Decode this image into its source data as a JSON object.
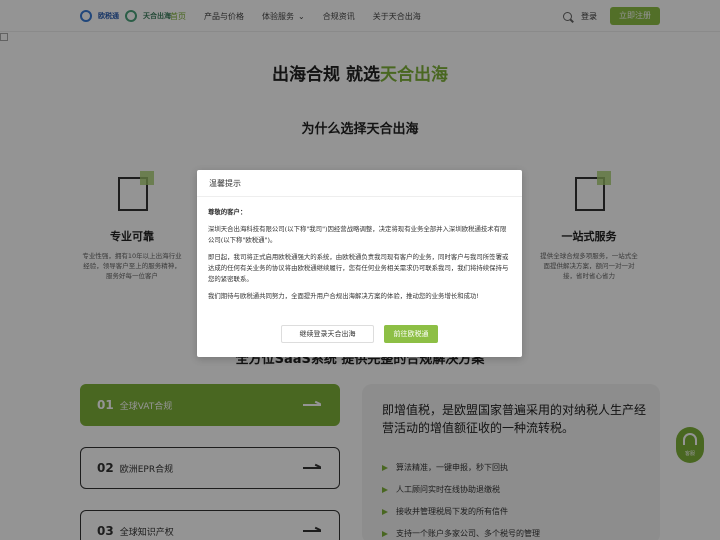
{
  "header": {
    "logo_text_1": "欧税通",
    "logo_text_2": "天合出海",
    "nav": [
      "首页",
      "产品与价格",
      "体验服务",
      "合规资讯",
      "关于天合出海"
    ],
    "login_label": "登录",
    "signup_label": "立即注册"
  },
  "hero": {
    "title_prefix": "出海合规 就选",
    "title_highlight": "天合出海"
  },
  "why": {
    "title": "为什么选择天合出海",
    "cards": [
      {
        "title": "专业可靠",
        "desc": "专业性强，拥有10年以上出海行业经验，领导客户至上的服务精神，服务好每一位客户"
      },
      {
        "title": "一站式服务",
        "desc": "提供全球合规多项服务，一站式全面提供解决方案，额问一对一对接，省时省心省力"
      }
    ]
  },
  "solutions": {
    "title": "全方位SaaS系统 提供完整的合规解决方案",
    "items": [
      {
        "num": "01",
        "label": "全球VAT合规"
      },
      {
        "num": "02",
        "label": "欧洲EPR合规"
      },
      {
        "num": "03",
        "label": "全球知识产权"
      }
    ],
    "detail_lead": "即增值税，是欧盟国家普遍采用的对纳税人生产经营活动的增值额征收的一种流转税。",
    "bullets": [
      "算法精准，一键申报，秒下回执",
      "人工顾问实时在线协助退缴税",
      "接收并管理税局下发的所有信件",
      "支持一个账户多家公司、多个税号的管理"
    ]
  },
  "float_service_label": "客服",
  "modal": {
    "title": "温馨提示",
    "greeting": "尊敬的客户：",
    "para1": "深圳天合出海科技有限公司(以下称\"我司\")因经营战略调整，决定将现有业务全部并入深圳欧税通技术有限公司(以下称\"欧税通\")。",
    "para2": "即日起，我司将正式启用欧税通强大的系统，由欧税通负责我司现有客户的业务，同时客户与我司所签署或达成的任何有关业务的协议将由欧税通继续履行，您有任何业务相关需求仍可联系我司，我们将持续保持与您的紧密联系。",
    "para3": "我们期待与欧税通共同努力，全面提升用户合规出海解决方案的体验，推动您的业务增长和成功!",
    "btn_continue": "继续登录天合出海",
    "btn_go": "前往欧税通"
  },
  "colors": {
    "accent": "#8dbf45",
    "accent_dark": "#7fb13a"
  }
}
